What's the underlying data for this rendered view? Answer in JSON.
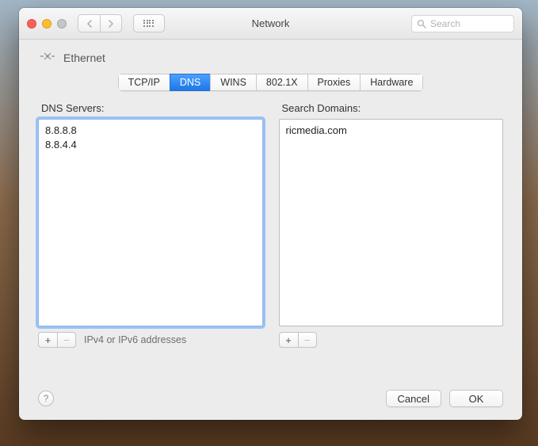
{
  "window": {
    "title": "Network"
  },
  "search": {
    "placeholder": "Search"
  },
  "breadcrumb": {
    "label": "Ethernet"
  },
  "tabs": [
    {
      "label": "TCP/IP"
    },
    {
      "label": "DNS"
    },
    {
      "label": "WINS"
    },
    {
      "label": "802.1X"
    },
    {
      "label": "Proxies"
    },
    {
      "label": "Hardware"
    }
  ],
  "active_tab_index": 1,
  "dns": {
    "servers_label": "DNS Servers:",
    "servers": [
      "8.8.8.8",
      "8.8.4.4"
    ],
    "hint": "IPv4 or IPv6 addresses",
    "domains_label": "Search Domains:",
    "domains": [
      "ricmedia.com"
    ]
  },
  "buttons": {
    "add": "+",
    "remove": "−",
    "cancel": "Cancel",
    "ok": "OK",
    "help": "?"
  }
}
